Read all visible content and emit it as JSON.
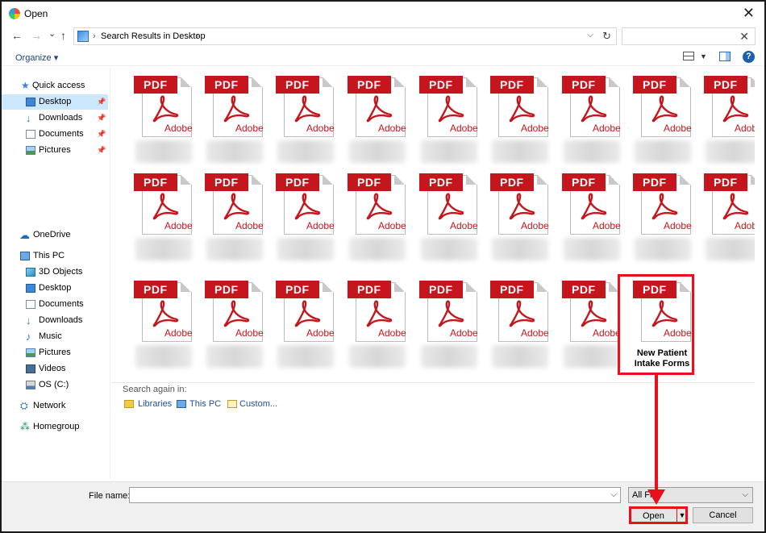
{
  "window": {
    "title": "Open",
    "close_symbol": "✕"
  },
  "nav": {
    "back_symbol": "←",
    "forward_symbol": "→",
    "recent_symbol": "⌄",
    "up_symbol": "↑",
    "address_path": "Search Results in Desktop",
    "address_sep": "›",
    "refresh_symbol": "↻",
    "search_clear": "✕"
  },
  "cmdbar": {
    "organize_label": "Organize ▾",
    "help_label": "?"
  },
  "sidebar": {
    "quick_access": "Quick access",
    "quick_items": [
      "Desktop",
      "Downloads",
      "Documents",
      "Pictures"
    ],
    "onedrive": "OneDrive",
    "this_pc": "This PC",
    "pc_items": [
      "3D Objects",
      "Desktop",
      "Documents",
      "Downloads",
      "Music",
      "Pictures",
      "Videos",
      "OS (C:)"
    ],
    "network": "Network",
    "homegroup": "Homegroup",
    "pin_symbol": "📌"
  },
  "files": {
    "icon_text": "PDF",
    "brand_text": "Adobe",
    "highlighted_name": "New Patient Intake Forms"
  },
  "search_again": {
    "label": "Search again in:",
    "libraries": "Libraries",
    "this_pc": "This PC",
    "custom": "Custom..."
  },
  "footer": {
    "filename_label": "File name:",
    "filename_value": "",
    "filter_value": "All File",
    "open_label": "Open",
    "cancel_label": "Cancel"
  },
  "colors": {
    "highlight": "#e8101a",
    "pdf_red": "#c4161c",
    "selected": "#cce8ff"
  }
}
